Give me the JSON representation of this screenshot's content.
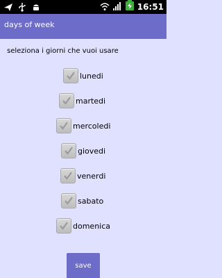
{
  "status_bar": {
    "time": "16:51",
    "icons_left": [
      "notification-icon",
      "usb-icon",
      "android-icon"
    ],
    "icons_right": [
      "wifi-icon",
      "signal-icon",
      "battery-charging-icon"
    ]
  },
  "title_bar": {
    "title": "days of week"
  },
  "prompt": "seleziona i giorni che vuoi usare",
  "days": [
    {
      "label": "lunedi",
      "checked": true
    },
    {
      "label": "martedi",
      "checked": true
    },
    {
      "label": "mercoledi",
      "checked": true
    },
    {
      "label": "giovedi",
      "checked": true
    },
    {
      "label": "venerdi",
      "checked": true
    },
    {
      "label": "sabato",
      "checked": true
    },
    {
      "label": "domenica",
      "checked": true
    }
  ],
  "save_button": {
    "label": "save"
  },
  "colors": {
    "background": "#e0e0ff",
    "accent": "#6e6cc9",
    "checkbox": "#c8c8c8",
    "checkmark": "#9a9a9a"
  }
}
